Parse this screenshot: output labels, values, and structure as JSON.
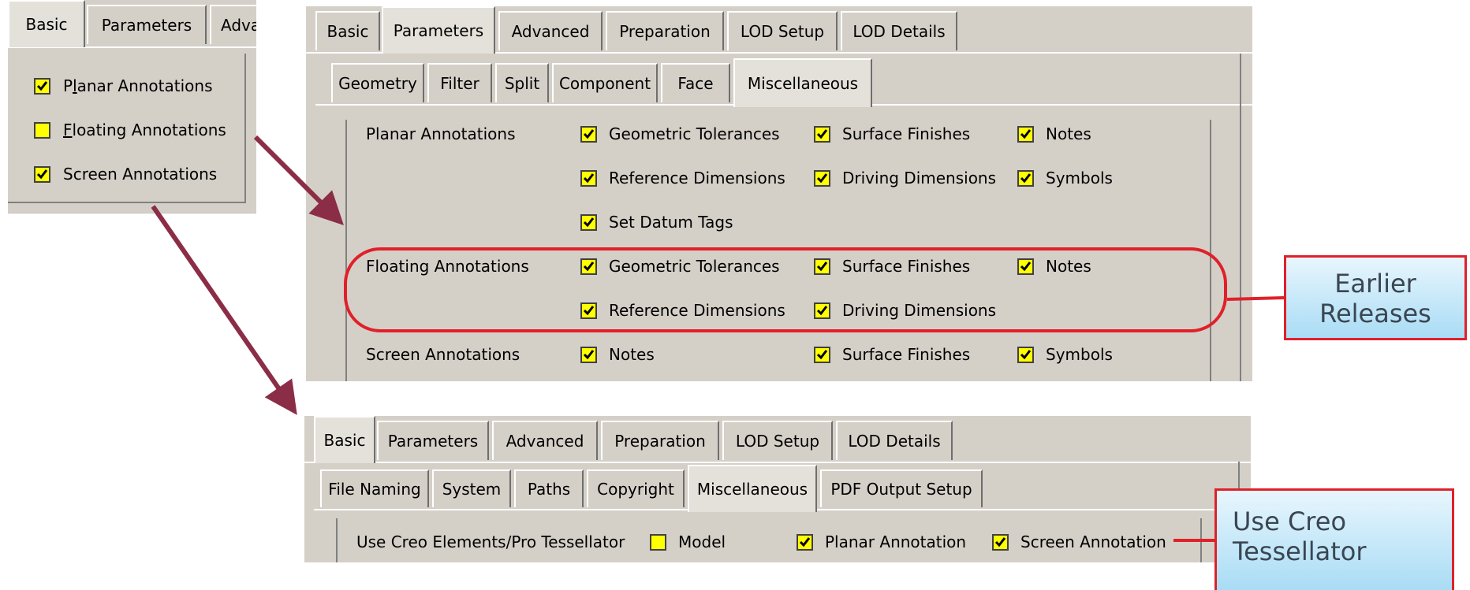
{
  "small_panel": {
    "tabs": [
      "Basic",
      "Parameters",
      "Adva"
    ],
    "items": [
      {
        "label": "Planar Annotations",
        "checked": true
      },
      {
        "label": "Floating Annotations",
        "checked": false
      },
      {
        "label": "Screen Annotations",
        "checked": true
      }
    ]
  },
  "panel_old": {
    "tabs": [
      "Basic",
      "Parameters",
      "Advanced",
      "Preparation",
      "LOD Setup",
      "LOD Details"
    ],
    "subtabs": [
      "Geometry",
      "Filter",
      "Split",
      "Component",
      "Face",
      "Miscellaneous"
    ],
    "rows": {
      "planar": {
        "label": "Planar Annotations",
        "items": [
          "Geometric Tolerances",
          "Surface Finishes",
          "Notes",
          "Reference Dimensions",
          "Driving Dimensions",
          "Symbols",
          "Set Datum Tags"
        ]
      },
      "floating": {
        "label": "Floating Annotations",
        "items": [
          "Geometric Tolerances",
          "Surface Finishes",
          "Notes",
          "Reference Dimensions",
          "Driving Dimensions"
        ]
      },
      "screen": {
        "label": "Screen Annotations",
        "items": [
          "Notes",
          "Surface Finishes",
          "Symbols"
        ]
      }
    }
  },
  "panel_new": {
    "tabs": [
      "Basic",
      "Parameters",
      "Advanced",
      "Preparation",
      "LOD Setup",
      "LOD Details"
    ],
    "subtabs": [
      "File Naming",
      "System",
      "Paths",
      "Copyright",
      "Miscellaneous",
      "PDF Output Setup"
    ],
    "row_label": "Use Creo Elements/Pro Tessellator",
    "items": [
      {
        "label": "Model",
        "checked": false
      },
      {
        "label": "Planar Annotation",
        "checked": true
      },
      {
        "label": "Screen Annotation",
        "checked": true
      }
    ]
  },
  "callouts": {
    "earlier": [
      "Earlier",
      "Releases"
    ],
    "tessellator": [
      "Use Creo",
      "Tessellator"
    ]
  },
  "colors": {
    "checkbox": "#ffff00",
    "callout_border": "#e0202a",
    "arrow": "#8b2d46",
    "panel": "#d4d0c8"
  }
}
